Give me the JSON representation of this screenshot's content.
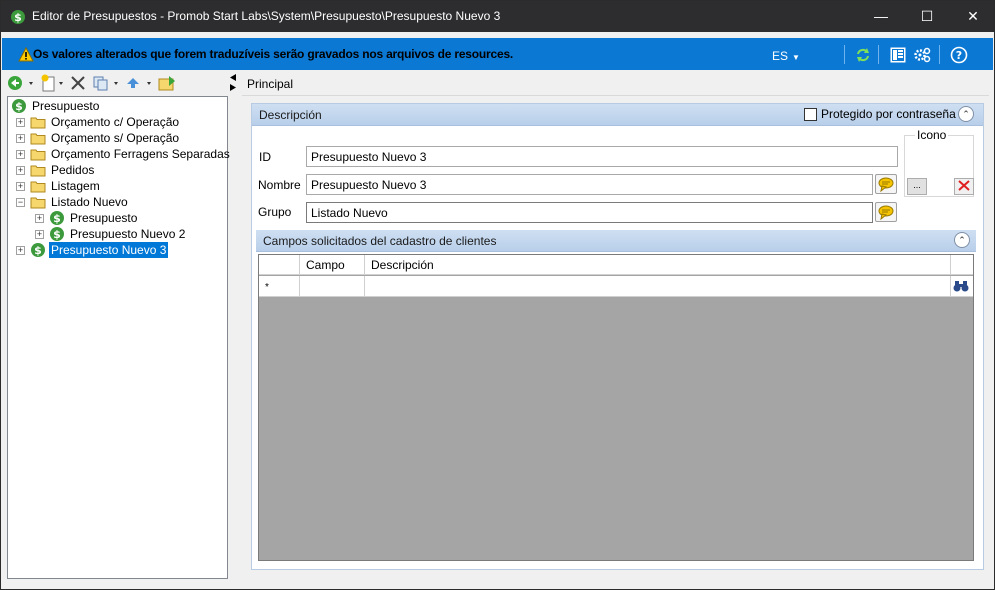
{
  "window": {
    "title": "Editor de Presupuestos - Promob Start Labs\\System\\Presupuesto\\Presupuesto Nuevo 3",
    "minimize": "—",
    "maximize": "☐",
    "close": "✕"
  },
  "infobar": {
    "message": "Os valores alterados que forem traduzíveis serão gravados nos arquivos de resources.",
    "language": "ES",
    "language_caret": "▼",
    "icons": [
      "refresh-icon",
      "layout-icon",
      "settings-icon",
      "help-icon"
    ]
  },
  "toolbar": {
    "icons": [
      "back-icon",
      "new-icon",
      "delete-icon",
      "copy-icon",
      "move-up-icon",
      "import-icon"
    ]
  },
  "tree": {
    "root": "Presupuesto",
    "items": [
      {
        "label": "Orçamento c/ Operação",
        "expander": "+"
      },
      {
        "label": "Orçamento s/ Operação",
        "expander": "+"
      },
      {
        "label": "Orçamento Ferragens Separadas",
        "expander": "+"
      },
      {
        "label": "Pedidos",
        "expander": "+"
      },
      {
        "label": "Listagem",
        "expander": "+"
      },
      {
        "label": "Listado Nuevo",
        "expander": "−"
      },
      {
        "label": "Presupuesto",
        "expander": "+"
      },
      {
        "label": "Presupuesto Nuevo 2",
        "expander": "+"
      },
      {
        "label": "Presupuesto Nuevo 3",
        "expander": "+"
      }
    ]
  },
  "main": {
    "tab": "Principal",
    "descripcion": {
      "title": "Descripción",
      "protected_label": "Protegido por contraseña",
      "protected_checked": false,
      "collapse": "⌃",
      "id_label": "ID",
      "id_value": "Presupuesto Nuevo 3",
      "nombre_label": "Nombre",
      "nombre_value": "Presupuesto Nuevo 3",
      "grupo_label": "Grupo",
      "grupo_value": "Listado Nuevo",
      "icono_label": "Icono",
      "browse": "...",
      "remove": "✕"
    },
    "campos": {
      "title": "Campos solicitados del cadastro de clientes",
      "collapse": "⌃",
      "columns": [
        "Campo",
        "Descripción"
      ],
      "new_row_marker": "*"
    }
  },
  "colors": {
    "titlebar": "#2d2d30",
    "infobar": "#0b78d4",
    "selection": "#0078d7",
    "group_header": "#c4d7ee",
    "grid_empty": "#a5a5a5"
  }
}
